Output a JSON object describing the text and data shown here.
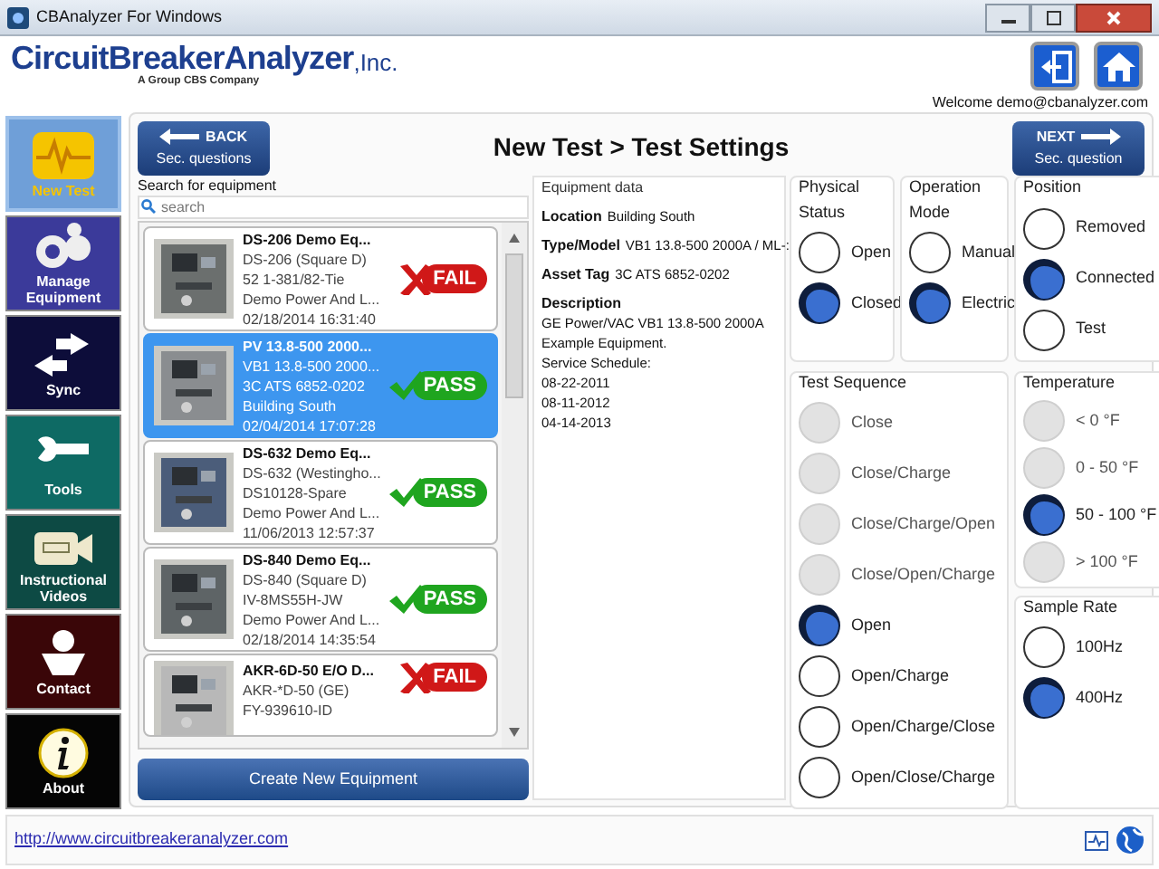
{
  "window": {
    "title": "CBAnalyzer For Windows"
  },
  "header": {
    "logo": "CircuitBreakerAnalyzer",
    "logo_suffix": ",Inc.",
    "tagline": "A Group CBS Company",
    "welcome": "Welcome demo@cbanalyzer.com"
  },
  "sidebar": {
    "items": [
      {
        "label": "New Test",
        "kind": "pulse",
        "color": "#6f9fd8",
        "selected": true
      },
      {
        "label": "Manage Equipment",
        "kind": "gears",
        "color": "#3b3a9a",
        "selected": false
      },
      {
        "label": "Sync",
        "kind": "sync",
        "color": "#0d0d3a",
        "selected": false
      },
      {
        "label": "Tools",
        "kind": "wrench",
        "color": "#0e6a64",
        "selected": false
      },
      {
        "label": "Instructional Videos",
        "kind": "camera",
        "color": "#0d4a44",
        "selected": false
      },
      {
        "label": "Contact",
        "kind": "person",
        "color": "#3a0608",
        "selected": false
      },
      {
        "label": "About",
        "kind": "info",
        "color": "#050505",
        "selected": false
      }
    ]
  },
  "toolbar": {
    "back": {
      "label": "BACK",
      "sub": "Sec. questions"
    },
    "title": "New Test > Test Settings",
    "next": {
      "label": "NEXT",
      "sub": "Sec. question"
    }
  },
  "search": {
    "label": "Search for equipment",
    "placeholder": "search"
  },
  "equipment": [
    {
      "title": "DS-206 Demo Eq...",
      "lines": [
        "DS-206 (Square D)",
        "52 1-381/82-Tie",
        "Demo Power And L...",
        "02/18/2014 16:31:40"
      ],
      "kind": "fail",
      "result_label": "FAIL",
      "selected": false
    },
    {
      "title": "PV 13.8-500 2000...",
      "lines": [
        "VB1 13.8-500 2000...",
        "3C ATS 6852-0202",
        "Building South",
        "02/04/2014 17:07:28"
      ],
      "kind": "pass",
      "result_label": "PASS",
      "selected": true
    },
    {
      "title": "DS-632 Demo Eq...",
      "lines": [
        "DS-632 (Westingho...",
        "DS10128-Spare",
        "Demo Power And L...",
        "11/06/2013 12:57:37"
      ],
      "kind": "pass",
      "result_label": "PASS",
      "selected": false
    },
    {
      "title": "DS-840 Demo Eq...",
      "lines": [
        "DS-840 (Square D)",
        "IV-8MS55H-JW",
        "Demo Power And L...",
        "02/18/2014 14:35:54"
      ],
      "kind": "pass",
      "result_label": "PASS",
      "selected": false
    },
    {
      "title": "AKR-6D-50 E/O D...",
      "lines": [
        "AKR-*D-50 (GE)",
        "FY-939610-ID"
      ],
      "kind": "fail",
      "result_label": "FAIL",
      "selected": false
    }
  ],
  "create_button": "Create New Equipment",
  "equipment_data": {
    "title": "Equipment data",
    "fields": [
      {
        "label": "Location",
        "value": "Building South"
      },
      {
        "label": "Type/Model",
        "value": "VB1 13.8-500 2000A / ML-:"
      },
      {
        "label": "Asset Tag",
        "value": "3C ATS 6852-0202"
      }
    ],
    "description_label": "Description",
    "description": [
      "GE Power/VAC VB1 13.8-500 2000A",
      "Example Equipment.",
      "Service Schedule:",
      "08-22-2011",
      "08-11-2012",
      "04-14-2013"
    ]
  },
  "groups": [
    {
      "title": "Physical Status",
      "options": [
        {
          "label": "Open",
          "selected": false,
          "disabled": false
        },
        {
          "label": "Closed",
          "selected": true,
          "disabled": false
        }
      ]
    },
    {
      "title": "Operation Mode",
      "options": [
        {
          "label": "Manual",
          "selected": false,
          "disabled": false
        },
        {
          "label": "Electric",
          "selected": true,
          "disabled": false
        }
      ]
    },
    {
      "title": "Position",
      "options": [
        {
          "label": "Removed",
          "selected": false,
          "disabled": false
        },
        {
          "label": "Connected",
          "selected": true,
          "disabled": false
        },
        {
          "label": "Test",
          "selected": false,
          "disabled": false
        }
      ]
    },
    {
      "title": "Test Sequence",
      "options": [
        {
          "label": "Close",
          "selected": false,
          "disabled": true
        },
        {
          "label": "Close/Charge",
          "selected": false,
          "disabled": true
        },
        {
          "label": "Close/Charge/Open",
          "selected": false,
          "disabled": true
        },
        {
          "label": "Close/Open/Charge",
          "selected": false,
          "disabled": true
        },
        {
          "label": "Open",
          "selected": true,
          "disabled": false
        },
        {
          "label": "Open/Charge",
          "selected": false,
          "disabled": false
        },
        {
          "label": "Open/Charge/Close",
          "selected": false,
          "disabled": false
        },
        {
          "label": "Open/Close/Charge",
          "selected": false,
          "disabled": false
        }
      ]
    },
    {
      "title": "Temperature",
      "options": [
        {
          "label": "< 0 °F",
          "selected": false,
          "disabled": true
        },
        {
          "label": "0 - 50 °F",
          "selected": false,
          "disabled": true
        },
        {
          "label": "50 - 100 °F",
          "selected": true,
          "disabled": false
        },
        {
          "label": "> 100 °F",
          "selected": false,
          "disabled": true
        }
      ]
    },
    {
      "title": "Sample Rate",
      "options": [
        {
          "label": "100Hz",
          "selected": false,
          "disabled": false
        },
        {
          "label": "400Hz",
          "selected": true,
          "disabled": false
        }
      ]
    }
  ],
  "footer": {
    "link": "http://www.circuitbreakeranalyzer.com"
  }
}
